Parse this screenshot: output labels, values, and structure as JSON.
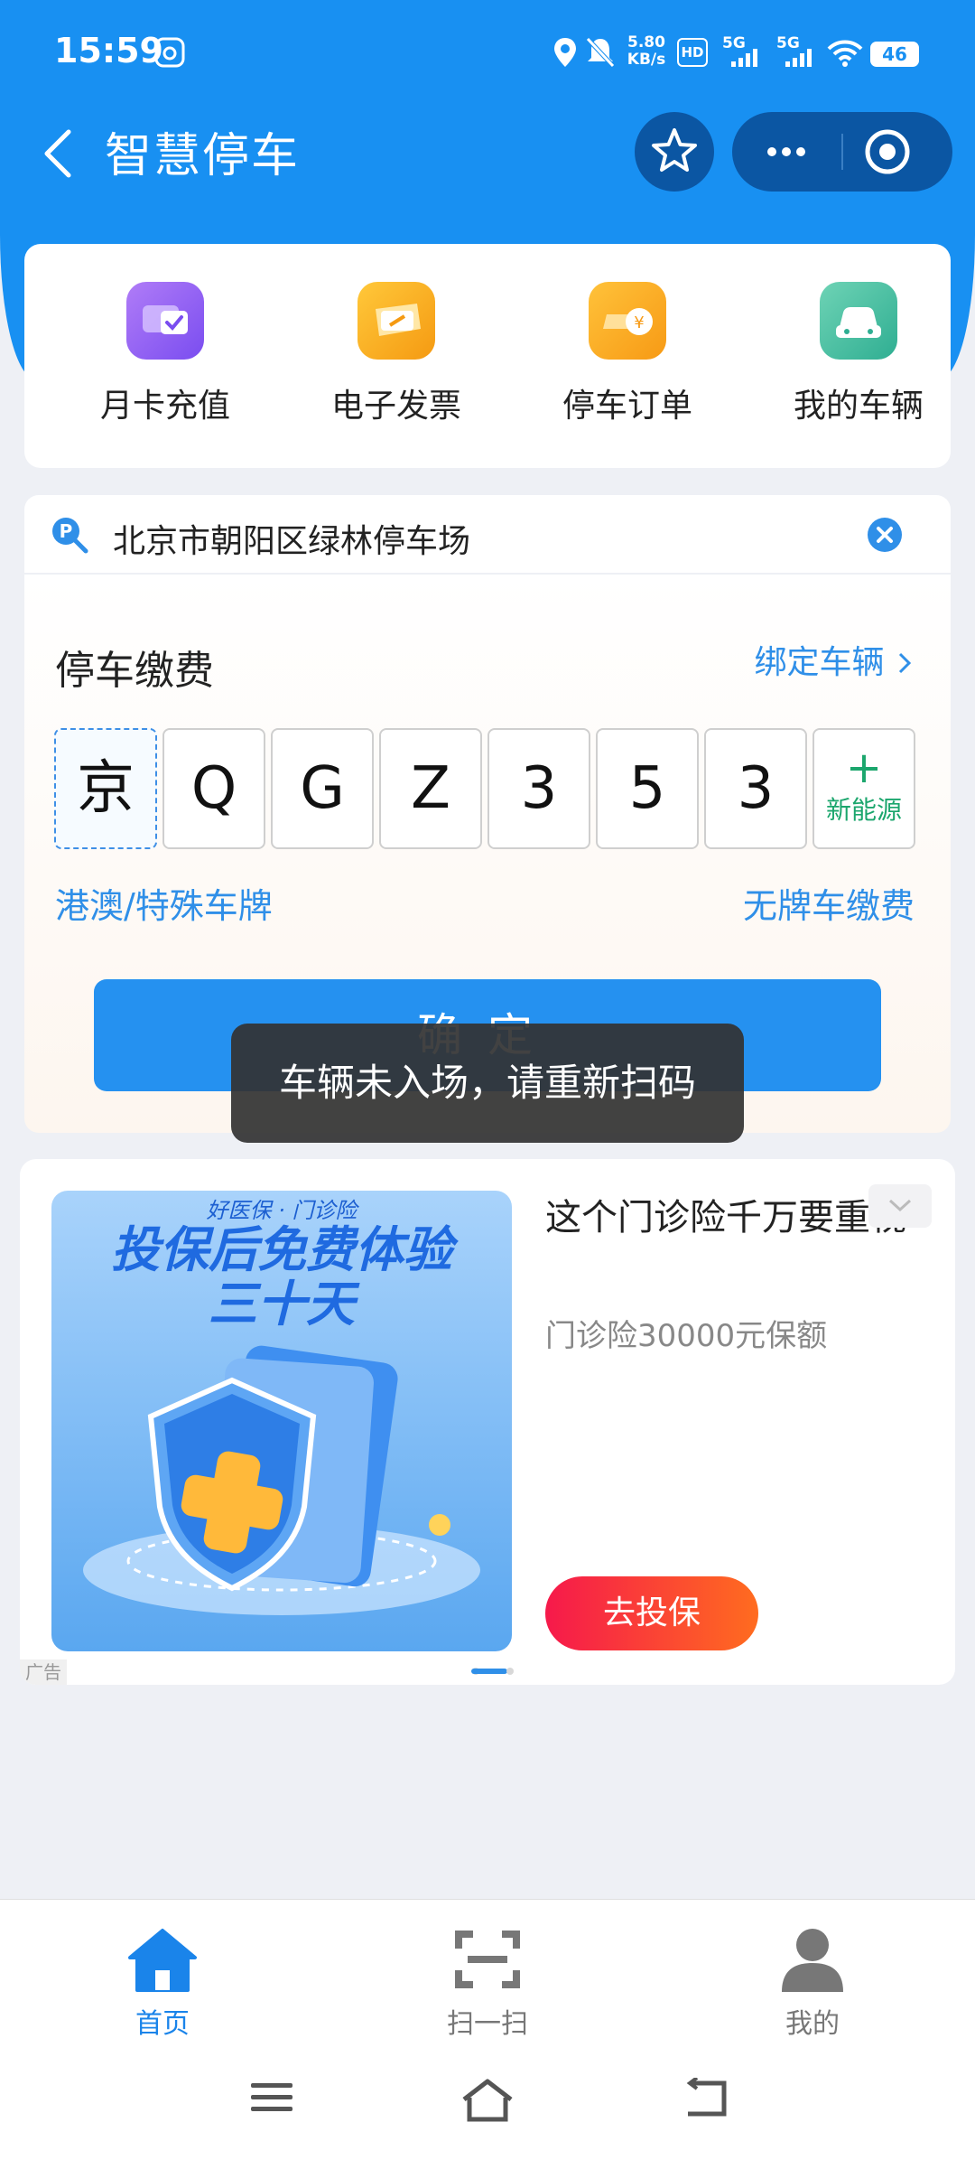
{
  "status_bar": {
    "time": "15:59",
    "net_speed_value": "5.80",
    "net_speed_unit": "KB/s",
    "hd_badge": "HD",
    "signal_5g_1": "5G",
    "signal_5g_2": "5G",
    "battery": "46"
  },
  "header": {
    "title": "智慧停车"
  },
  "quick_actions": [
    {
      "label": "月卡充值",
      "icon": "card-check-icon",
      "color": "#8b5cf6"
    },
    {
      "label": "电子发票",
      "icon": "invoice-icon",
      "color": "#f5a31a"
    },
    {
      "label": "停车订单",
      "icon": "order-car-icon",
      "color": "#f7a51f"
    },
    {
      "label": "我的车辆",
      "icon": "car-icon",
      "color": "#39b49a"
    }
  ],
  "search": {
    "value": "北京市朝阳区绿林停车场"
  },
  "payment": {
    "title": "停车缴费",
    "bind_link": "绑定车辆",
    "plate_chars": [
      "京",
      "Q",
      "G",
      "Z",
      "3",
      "5",
      "3"
    ],
    "new_energy_plus": "+",
    "new_energy_label": "新能源",
    "special_plate_link": "港澳/特殊车牌",
    "no_plate_link": "无牌车缴费",
    "confirm_label": "确定"
  },
  "toast": {
    "message": "车辆未入场，请重新扫码"
  },
  "ad": {
    "image_top_text": "好医保 · 门诊险",
    "image_headline_1": "投保后免费体验",
    "image_headline_2": "三十天",
    "title": "这个门诊险千万要重视",
    "subtitle": "门诊险30000元保额",
    "cta": "去投保",
    "tag": "广告"
  },
  "tab_bar": {
    "items": [
      {
        "label": "首页",
        "active": true
      },
      {
        "label": "扫一扫",
        "active": false
      },
      {
        "label": "我的",
        "active": false
      }
    ]
  },
  "colors": {
    "brand_blue": "#1890f2",
    "link_blue": "#2f8fe8",
    "tab_active": "#1a84ea",
    "tab_inactive": "#777777"
  }
}
